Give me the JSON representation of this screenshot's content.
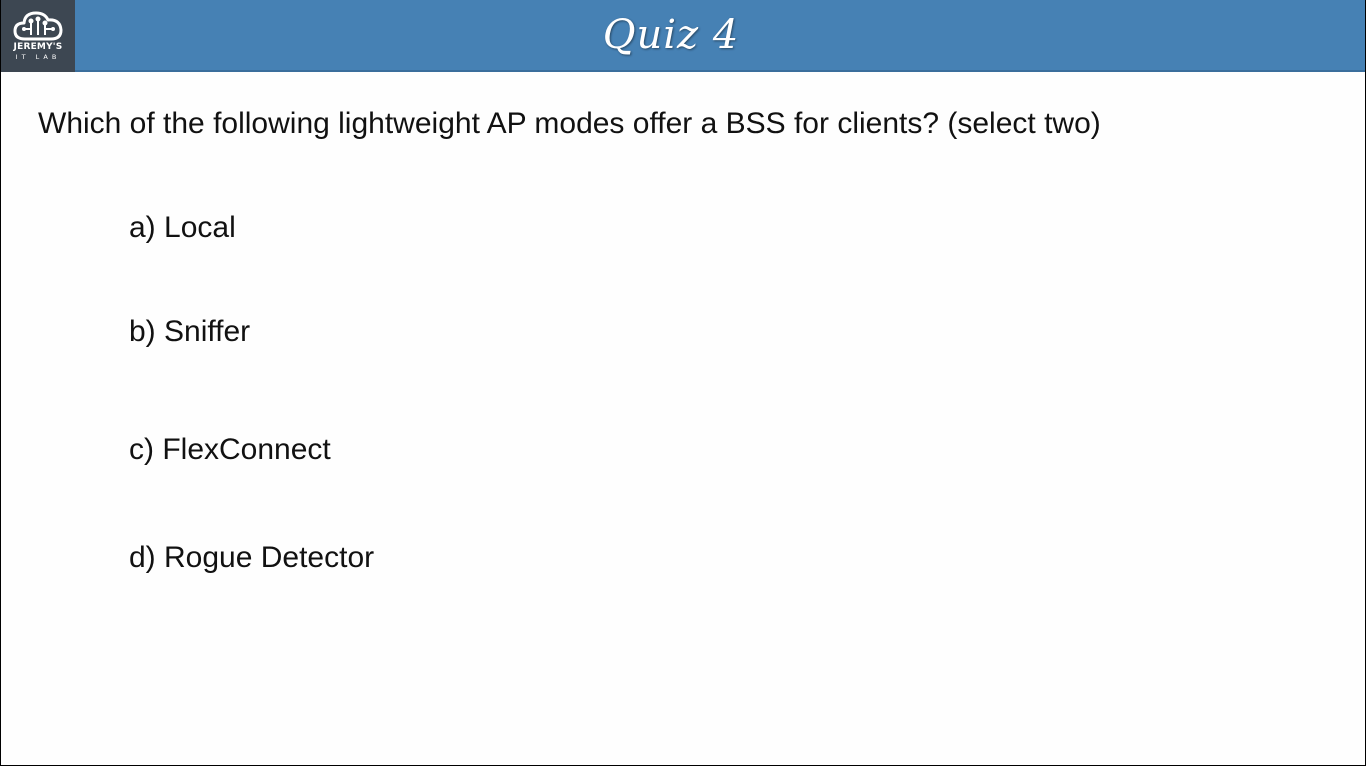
{
  "logo": {
    "line1": "JEREMY'S",
    "line2": "IT LAB",
    "icon": "cloud-circuit-icon"
  },
  "header": {
    "title": "Quiz 4"
  },
  "question": {
    "text": "Which of the following lightweight AP modes offer a BSS for clients? (select two)"
  },
  "options": [
    {
      "label": "a) Local"
    },
    {
      "label": "b) Sniffer"
    },
    {
      "label": "c) FlexConnect"
    },
    {
      "label": "d) Rogue Detector"
    }
  ],
  "colors": {
    "header_bg": "#4681b4",
    "logo_bg": "#3d4752",
    "text": "#111111",
    "page_bg": "#fefefe"
  }
}
